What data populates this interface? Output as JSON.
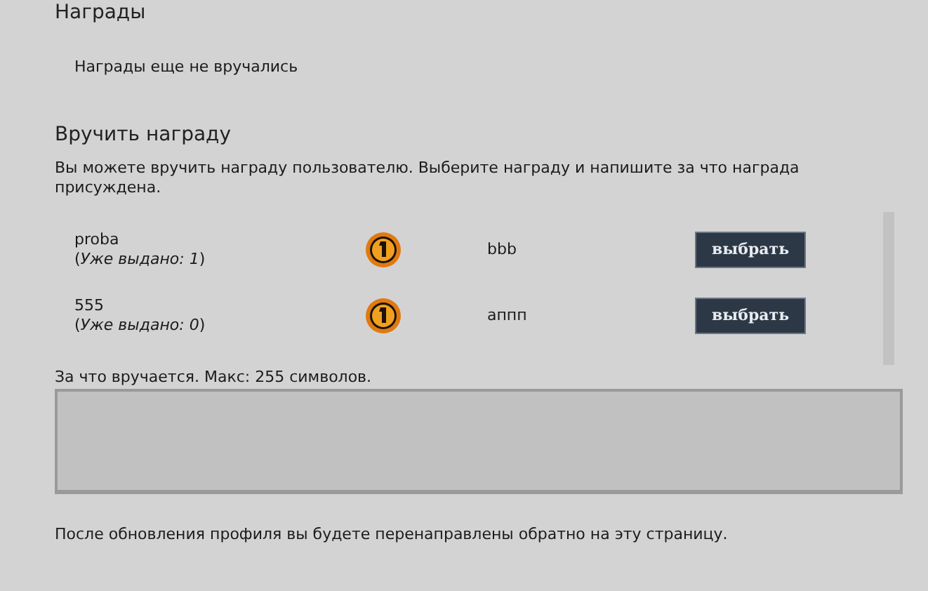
{
  "awards_section": {
    "title": "Награды",
    "empty_message": "Награды еще не вручались"
  },
  "give_section": {
    "title": "Вручить награду",
    "intro": "Вы можете вручить награду пользователю. Выберите награду и напишите за что награда присуждена.",
    "awards": [
      {
        "name": "proba",
        "issued": "(*Уже выдано: 1*)",
        "description": "bbb",
        "button": "выбрать"
      },
      {
        "name": "555",
        "issued": "(*Уже выдано: 0*)",
        "description": "аппп",
        "button": "выбрать"
      }
    ],
    "reason_label": "За что вручается. Макс: 255 символов."
  },
  "footer_note": "После обновления профиля вы будете перенаправлены обратно на эту страницу."
}
